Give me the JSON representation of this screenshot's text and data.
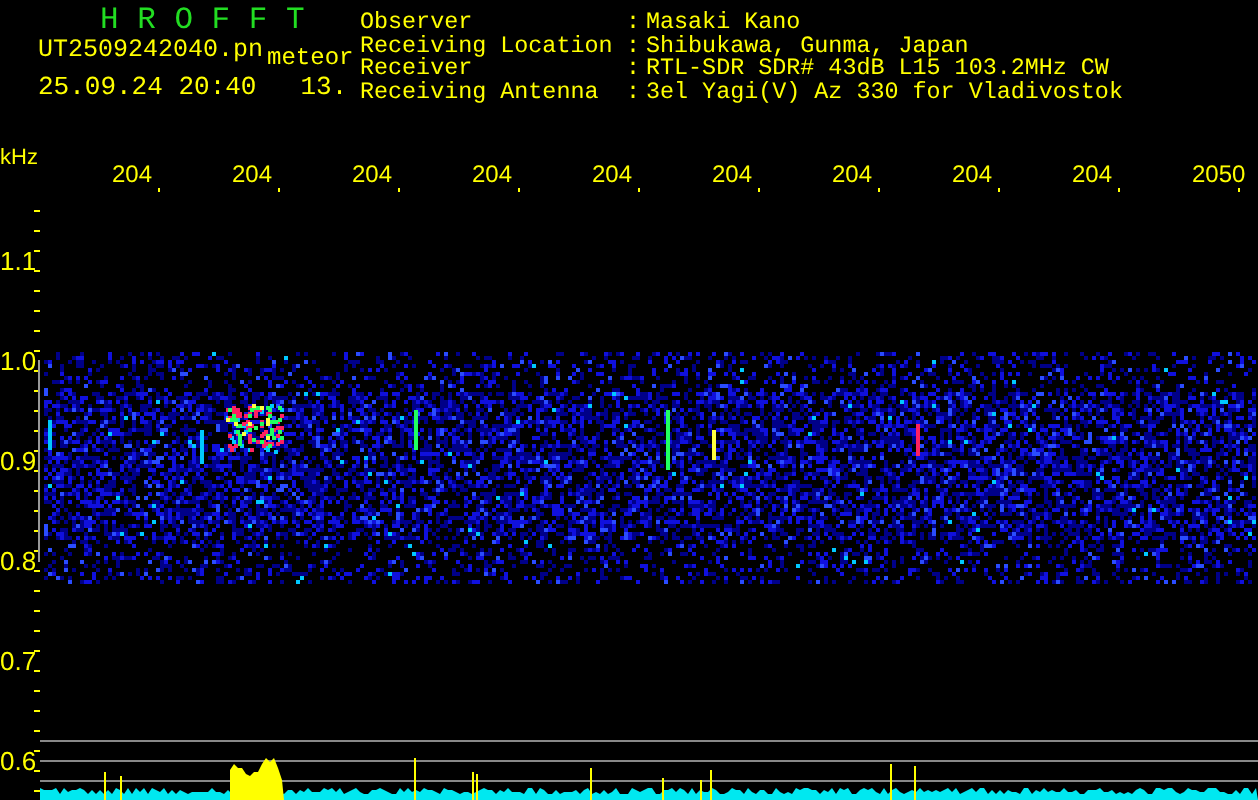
{
  "app_title": "H R O F F T",
  "file_name": "UT2509242040.pn",
  "event_type": "meteor",
  "timestamp": "25.09.24 20:40",
  "count": "13.",
  "station_info": [
    {
      "label": "Observer",
      "separator": ":",
      "value": "Masaki Kano"
    },
    {
      "label": "Receiving Location",
      "separator": ":",
      "value": "Shibukawa, Gunma, Japan"
    },
    {
      "label": "Receiver",
      "separator": ":",
      "value": "RTL-SDR SDR# 43dB L15 103.2MHz CW"
    },
    {
      "label": "Receiving Antenna",
      "separator": ":",
      "value": "3el Yagi(V) Az 330 for Vladivostok"
    }
  ],
  "spectrogram": {
    "y_unit": "kHz",
    "y_labels": [
      "1.1",
      "1.0",
      "0.9",
      "0.8",
      "0.7",
      "0.6"
    ],
    "x_labels": [
      "204",
      "204",
      "204",
      "204",
      "204",
      "204",
      "204",
      "204",
      "204",
      "2050"
    ]
  }
}
